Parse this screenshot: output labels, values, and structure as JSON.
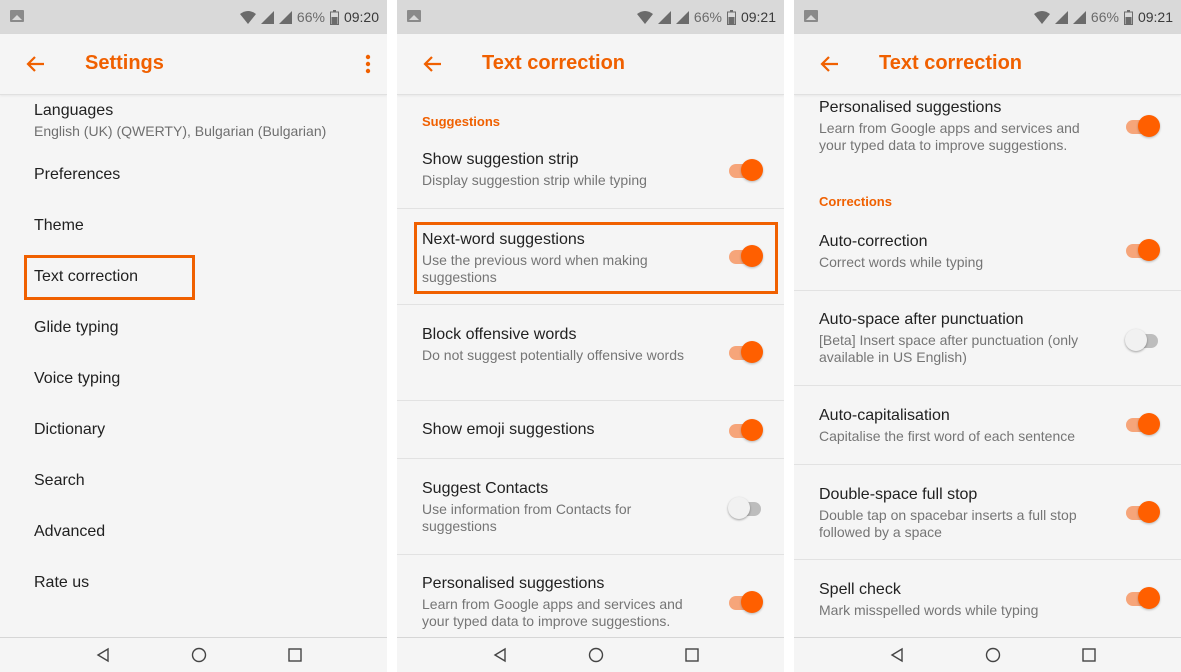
{
  "accent_color": "#f06000",
  "screens": [
    {
      "status": {
        "battery": "66%",
        "time": "09:20"
      },
      "title": "Settings",
      "items": [
        {
          "label": "Languages",
          "sub": "English (UK) (QWERTY), Bulgarian (Bulgarian)"
        },
        {
          "label": "Preferences"
        },
        {
          "label": "Theme"
        },
        {
          "label": "Text correction"
        },
        {
          "label": "Glide typing"
        },
        {
          "label": "Voice typing"
        },
        {
          "label": "Dictionary"
        },
        {
          "label": "Search"
        },
        {
          "label": "Advanced"
        },
        {
          "label": "Rate us"
        }
      ]
    },
    {
      "status": {
        "battery": "66%",
        "time": "09:21"
      },
      "title": "Text correction",
      "section": "Suggestions",
      "rows": [
        {
          "title": "Show suggestion strip",
          "summary": "Display suggestion strip while typing",
          "checked": true
        },
        {
          "title": "Next-word suggestions",
          "summary": "Use the previous word when making suggestions",
          "checked": true
        },
        {
          "title": "Block offensive words",
          "summary": "Do not suggest potentially offensive words",
          "checked": true
        },
        {
          "title": "Show emoji suggestions",
          "summary": "",
          "checked": true
        },
        {
          "title": "Suggest Contacts",
          "summary": "Use information from Contacts for suggestions",
          "checked": false
        },
        {
          "title": "Personalised suggestions",
          "summary": "Learn from Google apps and services and your typed data to improve suggestions.",
          "checked": true
        }
      ]
    },
    {
      "status": {
        "battery": "66%",
        "time": "09:21"
      },
      "title": "Text correction",
      "top_row": {
        "title": "Personalised suggestions",
        "summary": "Learn from Google apps and services and your typed data to improve suggestions.",
        "checked": true
      },
      "section": "Corrections",
      "rows": [
        {
          "title": "Auto-correction",
          "summary": "Correct words while typing",
          "checked": true
        },
        {
          "title": "Auto-space after punctuation",
          "summary": "[Beta] Insert space after punctuation (only available in US English)",
          "checked": false
        },
        {
          "title": "Auto-capitalisation",
          "summary": "Capitalise the first word of each sentence",
          "checked": true
        },
        {
          "title": "Double-space full stop",
          "summary": "Double tap on spacebar inserts a full stop followed by a space",
          "checked": true
        },
        {
          "title": "Spell check",
          "summary": "Mark misspelled words while typing",
          "checked": true
        }
      ]
    }
  ]
}
